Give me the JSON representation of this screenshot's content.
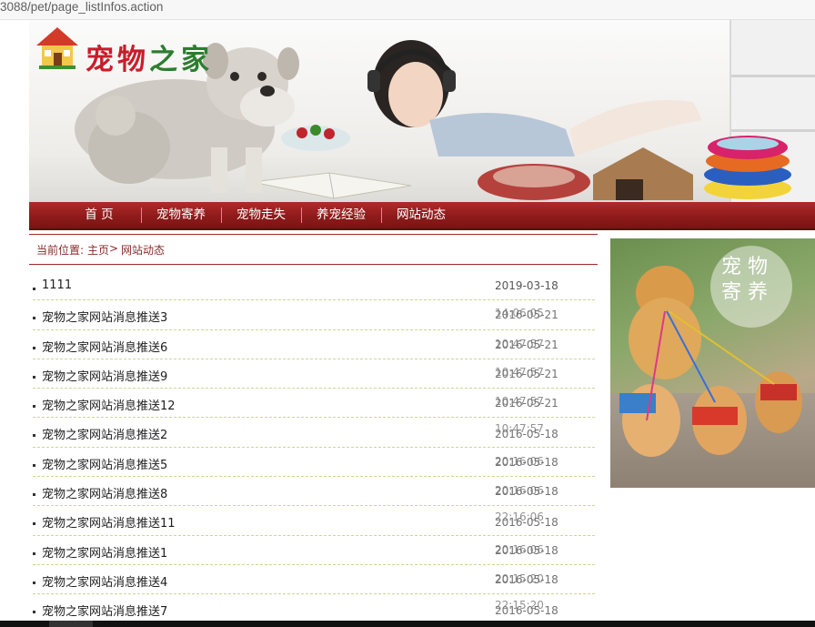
{
  "browser": {
    "url": "3088/pet/page_listInfos.action"
  },
  "header": {
    "logo_chars": [
      "宠",
      "物",
      "之",
      "家"
    ],
    "logo_icon": "house-icon"
  },
  "nav": {
    "items": [
      {
        "label": "首 页"
      },
      {
        "label": "宠物寄养"
      },
      {
        "label": "宠物走失"
      },
      {
        "label": "养宠经验"
      },
      {
        "label": "网站动态"
      }
    ]
  },
  "breadcrumb": {
    "prefix": "当前位置: ",
    "home": "主页",
    "sep": " > ",
    "current": "网站动态"
  },
  "news": [
    {
      "title": "1111",
      "date": "2019-03-18",
      "date_overlap": ""
    },
    {
      "title": "宠物之家网站消息推送3",
      "date": "2016-05-21",
      "date_overlap": "14:06:05"
    },
    {
      "title": "宠物之家网站消息推送6",
      "date": "2016-05-21",
      "date_overlap": "10:47:57"
    },
    {
      "title": "宠物之家网站消息推送9",
      "date": "2016-05-21",
      "date_overlap": "10:47:57"
    },
    {
      "title": "宠物之家网站消息推送12",
      "date": "2016-05-21",
      "date_overlap": "10:47:57"
    },
    {
      "title": "宠物之家网站消息推送2",
      "date": "2016-05-18",
      "date_overlap": "10:47:57"
    },
    {
      "title": "宠物之家网站消息推送5",
      "date": "2016-05-18",
      "date_overlap": "20:16:06"
    },
    {
      "title": "宠物之家网站消息推送8",
      "date": "2016-05-18",
      "date_overlap": "20:16:06"
    },
    {
      "title": "宠物之家网站消息推送11",
      "date": "2016-05-18",
      "date_overlap": "22:16:06"
    },
    {
      "title": "宠物之家网站消息推送1",
      "date": "2016-05-18",
      "date_overlap": "20:16:06"
    },
    {
      "title": "宠物之家网站消息推送4",
      "date": "2016-05-18",
      "date_overlap": "20:15:20"
    },
    {
      "title": "宠物之家网站消息推送7",
      "date": "2016-05-18",
      "date_overlap": "22:15:20"
    }
  ],
  "promo": {
    "text_chars": [
      "宠",
      "物",
      "寄",
      "养"
    ]
  },
  "colors": {
    "nav_bg": "#8e1b1b",
    "crumb_text": "#8a2b2b",
    "divider": "#c9d79a"
  }
}
